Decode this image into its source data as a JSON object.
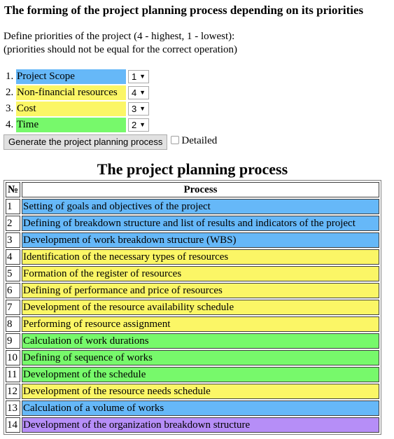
{
  "header": {
    "title": "The forming of the project planning process depending on its priorities",
    "intro_line1": "Define priorities of the project (4 - highest, 1 - lowest):",
    "intro_line2": "(priorities should not be equal for the correct operation)"
  },
  "colors": {
    "scope": "#66b8f8",
    "resources": "#fbf666",
    "cost": "#fbf666",
    "time": "#77f96b",
    "organization": "#b68ef7"
  },
  "priorities": [
    {
      "num": "1.",
      "label": "Project Scope",
      "value": "1",
      "color": "#66b8f8"
    },
    {
      "num": "2.",
      "label": "Non-financial resources",
      "value": "4",
      "color": "#fbf666"
    },
    {
      "num": "3.",
      "label": "Cost",
      "value": "3",
      "color": "#fbf666"
    },
    {
      "num": "4.",
      "label": "Time",
      "value": "2",
      "color": "#77f96b"
    }
  ],
  "controls": {
    "generate_label": "Generate the project planning process",
    "detailed_label": "Detailed",
    "detailed_checked": false,
    "dropdown_arrow": "▼"
  },
  "table": {
    "title": "The project planning process",
    "headers": {
      "num": "№",
      "process": "Process"
    },
    "rows": [
      {
        "num": "1",
        "process": "Setting of goals and objectives of the project",
        "color": "#66b8f8"
      },
      {
        "num": "2",
        "process": "Defining of breakdown structure and list of results and indicators of the project",
        "color": "#66b8f8"
      },
      {
        "num": "3",
        "process": "Development of work breakdown structure (WBS)",
        "color": "#66b8f8"
      },
      {
        "num": "4",
        "process": "Identification of the necessary types of resources",
        "color": "#fbf666"
      },
      {
        "num": "5",
        "process": "Formation of the register of resources",
        "color": "#fbf666"
      },
      {
        "num": "6",
        "process": "Defining of performance and price of resources",
        "color": "#fbf666"
      },
      {
        "num": "7",
        "process": "Development of the resource availability schedule",
        "color": "#fbf666"
      },
      {
        "num": "8",
        "process": "Performing of resource assignment",
        "color": "#fbf666"
      },
      {
        "num": "9",
        "process": "Calculation of work durations",
        "color": "#77f96b"
      },
      {
        "num": "10",
        "process": "Defining of sequence of works",
        "color": "#77f96b"
      },
      {
        "num": "11",
        "process": "Development of the schedule",
        "color": "#77f96b"
      },
      {
        "num": "12",
        "process": "Development of the resource needs schedule",
        "color": "#fbf666"
      },
      {
        "num": "13",
        "process": "Calculation of a volume of works",
        "color": "#66b8f8"
      },
      {
        "num": "14",
        "process": "Development of the organization breakdown structure",
        "color": "#b68ef7"
      }
    ]
  }
}
